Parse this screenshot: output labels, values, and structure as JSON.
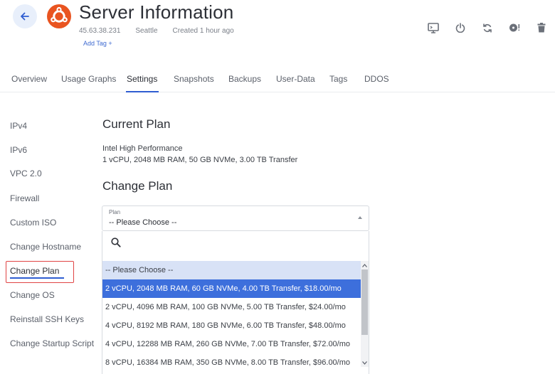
{
  "header": {
    "title": "Server Information",
    "ip": "45.63.38.231",
    "location": "Seattle",
    "created": "Created 1 hour ago",
    "add_tag": "Add Tag +",
    "os_icon": "ubuntu-logo-icon",
    "actions": [
      "console-icon",
      "power-icon",
      "restart-icon",
      "iso-icon",
      "trash-icon"
    ]
  },
  "tabs": [
    "Overview",
    "Usage Graphs",
    "Settings",
    "Snapshots",
    "Backups",
    "User-Data",
    "Tags",
    "DDOS"
  ],
  "active_tab": "Settings",
  "sidebar": {
    "items": [
      "IPv4",
      "IPv6",
      "VPC 2.0",
      "Firewall",
      "Custom ISO",
      "Change Hostname",
      "Change Plan",
      "Change OS",
      "Reinstall SSH Keys",
      "Change Startup Script"
    ],
    "active": "Change Plan"
  },
  "current_plan": {
    "heading": "Current Plan",
    "name": "Intel High Performance",
    "specs": "1 vCPU, 2048 MB RAM, 50 GB NVMe, 3.00 TB Transfer"
  },
  "change_plan": {
    "heading": "Change Plan",
    "select_label": "Plan",
    "select_value": "-- Please Choose --",
    "search_placeholder": "",
    "options": [
      "-- Please Choose --",
      "2 vCPU, 2048 MB RAM, 60 GB NVMe, 4.00 TB Transfer, $18.00/mo",
      "2 vCPU, 4096 MB RAM, 100 GB NVMe, 5.00 TB Transfer, $24.00/mo",
      "4 vCPU, 8192 MB RAM, 180 GB NVMe, 6.00 TB Transfer, $48.00/mo",
      "4 vCPU, 12288 MB RAM, 260 GB NVMe, 7.00 TB Transfer, $72.00/mo",
      "8 vCPU, 16384 MB RAM, 350 GB NVMe, 8.00 TB Transfer, $96.00/mo"
    ],
    "highlighted_option": 1
  },
  "colors": {
    "accent": "#2f5dd1",
    "option_selected": "#3d6fdc",
    "option_placeholder": "#d8e2f6",
    "ubuntu_orange": "#e95420",
    "highlight_border": "#e04444"
  }
}
